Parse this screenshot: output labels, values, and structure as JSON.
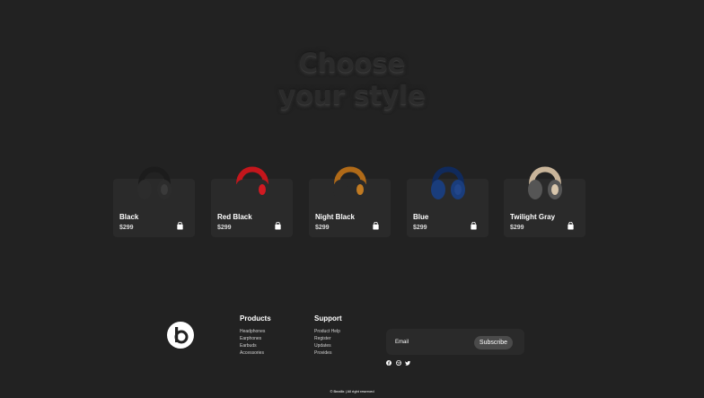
{
  "hero": {
    "title_line1": "Choose",
    "title_line2": "your style"
  },
  "products": [
    {
      "name": "Black",
      "price": "$299",
      "colors": {
        "band": "#1c1c1c",
        "cup": "#2c2c2c",
        "accent": "#3a3a3a"
      },
      "icon": "headphones-black-icon"
    },
    {
      "name": "Red Black",
      "price": "$299",
      "colors": {
        "band": "#c4161c",
        "cup": "#2a2a2a",
        "accent": "#d11a22"
      },
      "icon": "headphones-red-icon"
    },
    {
      "name": "Night Black",
      "price": "$299",
      "colors": {
        "band": "#b06a18",
        "cup": "#2a2a2a",
        "accent": "#c07a22"
      },
      "icon": "headphones-gold-icon"
    },
    {
      "name": "Blue",
      "price": "$299",
      "colors": {
        "band": "#102a5c",
        "cup": "#1a3d7c",
        "accent": "#22468a"
      },
      "icon": "headphones-blue-icon"
    },
    {
      "name": "Twilight Gray",
      "price": "$299",
      "colors": {
        "band": "#c9b59a",
        "cup": "#555555",
        "accent": "#d8c6ac"
      },
      "icon": "headphones-gray-icon"
    }
  ],
  "footer": {
    "products_title": "Products",
    "products_links": [
      "Headphones",
      "Earphones",
      "Earbuds",
      "Accessories"
    ],
    "support_title": "Support",
    "support_links": [
      "Product Help",
      "Register",
      "Updates",
      "Provides"
    ],
    "email_label": "Email",
    "subscribe_label": "Subscribe",
    "copyright": "© Beatlix | All right reserved"
  },
  "colors": {
    "background": "#222222",
    "card": "#2a2a2a",
    "button": "#4a4a4a"
  }
}
